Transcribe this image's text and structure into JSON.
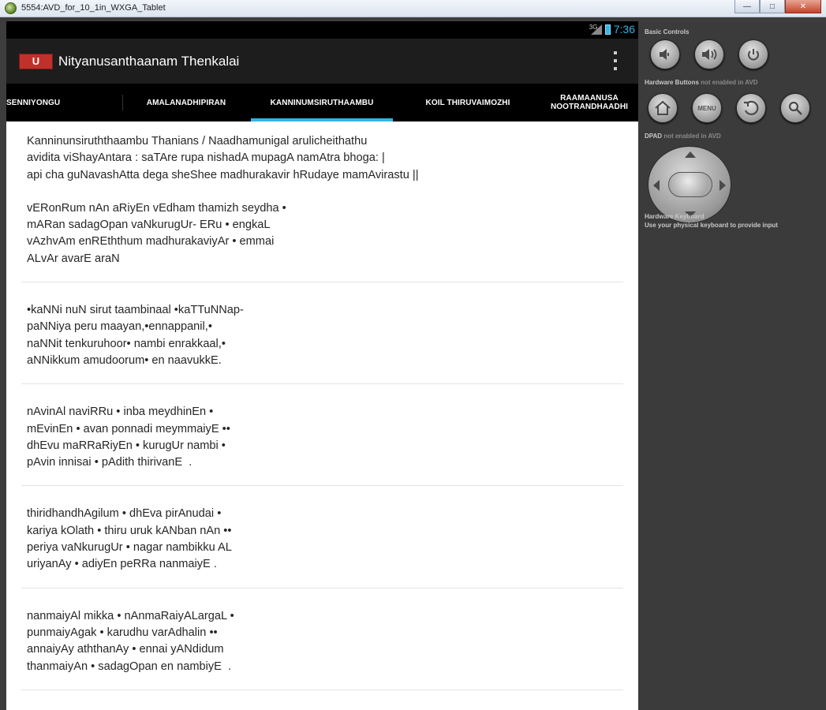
{
  "window": {
    "title": "5554:AVD_for_10_1in_WXGA_Tablet",
    "minimize_label": "—",
    "maximize_label": "□",
    "close_label": "✕"
  },
  "status_bar": {
    "network": "3G",
    "time": "7:36"
  },
  "action_bar": {
    "logo_text": "U",
    "title": "Nityanusanthaanam Thenkalai"
  },
  "tabs": [
    {
      "label": "SENNIYONGU",
      "selected": false
    },
    {
      "label": "AMALANADHIPIRAN",
      "selected": false
    },
    {
      "label": "KANNINUMSIRUTHAAMBU",
      "selected": true
    },
    {
      "label": "KOIL THIRUVAIMOZHI",
      "selected": false
    },
    {
      "label": "RAAMAANUSA NOOTRANDHAADHI",
      "selected": false
    }
  ],
  "content": {
    "intro": [
      "Kanninunsiruththaambu Thanians / Naadhamunigal arulicheithathu",
      "avidita viShayAntara : saTAre rupa nishadA mupagA namAtra bhoga: |",
      "api cha guNavashAtta dega sheShee madhurakavir hRudaye mamAvirastu ||"
    ],
    "intro_verse": [
      "vERonRum nAn aRiyEn vEdham thamizh seydha •",
      "mARan sadagOpan vaNkurugUr- ERu • engkaL",
      "vAzhvAm enREththum madhurakaviyAr • emmai",
      "ALvAr avarE araN"
    ],
    "verses": [
      [
        "•kaNNi nuN sirut taambinaal •kaTTuNNap-",
        "paNNiya peru maayan,•ennappanil,•",
        "naNNit tenkuruhoor• nambi enrakkaal,•",
        "aNNikkum amudoorum• en naavukkE."
      ],
      [
        "nAvinAl naviRRu • inba meydhinEn •",
        "mEvinEn • avan ponnadi meymmaiyE ••",
        "dhEvu maRRaRiyEn • kurugUr nambi •",
        "pAvin innisai • pAdith thirivanE  ."
      ],
      [
        "thiridhandhAgilum • dhEva pirAnudai •",
        "kariya kOlath • thiru uruk kANban nAn ••",
        "periya vaNkurugUr • nagar nambikku AL",
        "uriyanAy • adiyEn peRRa nanmaiyE ."
      ],
      [
        "nanmaiyAl mikka • nAnmaRaiyALargaL •",
        "punmaiyAgak • karudhu varAdhalin ••",
        "annaiyAy aththanAy • ennai yANdidum",
        "thanmaiyAn • sadagOpan en nambiyE  ."
      ]
    ]
  },
  "controls": {
    "basic_controls": "Basic Controls",
    "hardware_buttons": "Hardware Buttons",
    "hardware_buttons_note": "not enabled in AVD",
    "dpad": "DPAD",
    "dpad_note": "not enabled in AVD",
    "hardware_keyboard": "Hardware Keyboard",
    "keyboard_note": "Use your physical keyboard to provide input",
    "menu_label": "MENU",
    "icons": [
      "volume-down-icon",
      "volume-up-icon",
      "power-icon",
      "home-icon",
      "menu-button",
      "back-icon",
      "search-icon"
    ]
  }
}
